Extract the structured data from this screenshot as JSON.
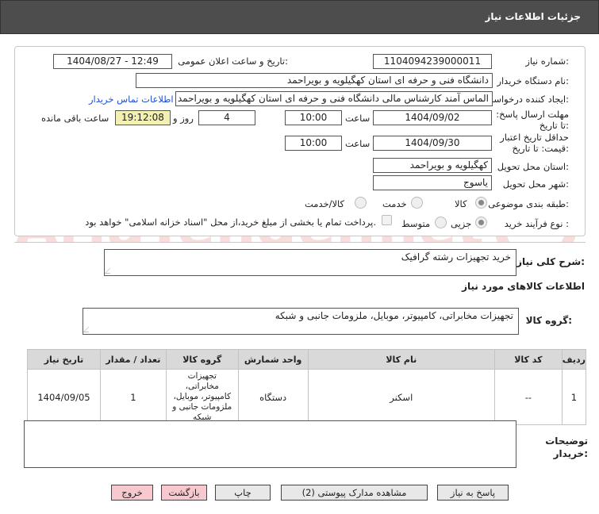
{
  "header": {
    "title": "جزئیات اطلاعات نیاز"
  },
  "form": {
    "need_number": {
      "label": "شماره نیاز:",
      "value": "1104094239000011"
    },
    "announce_datetime": {
      "label": "تاریخ و ساعت اعلان عمومی:",
      "value": "1404/08/27 - 12:49"
    },
    "buyer_org": {
      "label": "نام دستگاه خریدار:",
      "value": "دانشگاه فنی و حرفه ای استان کهگیلویه و بویراحمد"
    },
    "creator": {
      "label": "ایجاد کننده درخواست:",
      "value": "الماس آمند کارشناس مالی دانشگاه فنی و حرفه ای استان کهگیلویه و بویراحمد"
    },
    "contact_link": "اطلاعات تماس خریدار",
    "reply_deadline": {
      "label": "مهلت ارسال پاسخ: تا تاریخ:",
      "date": "1404/09/02",
      "time_label": "ساعت",
      "time": "10:00",
      "days": "4",
      "days_label": "روز و",
      "remaining": "19:12:08",
      "remaining_label": "ساعت باقی مانده"
    },
    "price_validity": {
      "label": "حداقل تاریخ اعتبار قیمت: تا تاریخ:",
      "date": "1404/09/30",
      "time_label": "ساعت",
      "time": "10:00"
    },
    "delivery_province": {
      "label": "استان محل تحویل:",
      "value": "کهگیلویه و بویراحمد"
    },
    "delivery_city": {
      "label": "شهر محل تحویل:",
      "value": "یاسوج"
    },
    "category": {
      "label": "طبقه بندی موضوعی:",
      "options": [
        "کالا",
        "خدمت",
        "کالا/خدمت"
      ],
      "selected": "کالا"
    },
    "process": {
      "label": "نوع فرآیند خرید :",
      "options": [
        "جزیی",
        "متوسط"
      ],
      "selected": "جزیی",
      "payment_note": "پرداخت تمام یا بخشی از مبلغ خرید،از محل \"اسناد خزانه اسلامی\" خواهد بود."
    }
  },
  "description": {
    "label": "شرح کلی نیاز:",
    "value": "خرید تجهیزات رشته گرافیک"
  },
  "goods_info": {
    "title": "اطلاعات کالاهای مورد نیاز"
  },
  "goods_group": {
    "label": "گروه کالا:",
    "value": "تجهیزات مخابراتی، کامپیوتر، موبایل، ملزومات جانبی و شبکه"
  },
  "table": {
    "headers": [
      "ردیف",
      "کد کالا",
      "نام کالا",
      "واحد شمارش",
      "گروه کالا",
      "تعداد / مقدار",
      "تاریخ نیاز"
    ],
    "rows": [
      [
        "1",
        "--",
        "اسکنر",
        "دستگاه",
        "تجهیزات مخابراتی، کامپیوتر، موبایل، ملزومات جانبی و شبکه",
        "1",
        "1404/09/05"
      ]
    ]
  },
  "buyer_notes": {
    "label": "توضیحات خریدار:",
    "value": ""
  },
  "buttons": {
    "reply": "پاسخ به نیاز",
    "attachments": "مشاهده مدارک پیوستی (2)",
    "print": "چاپ",
    "back": "بازگشت",
    "exit": "خروج"
  },
  "watermark": "AriaTender.net"
}
